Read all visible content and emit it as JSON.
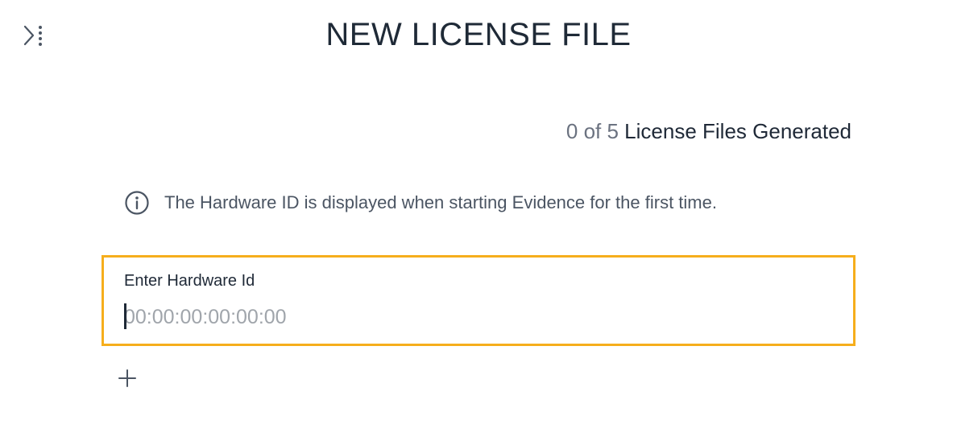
{
  "header": {
    "title": "NEW LICENSE FILE",
    "toggle_icon": "sidebar-expand-icon"
  },
  "counter": {
    "count_text": "0 of 5",
    "label": " License Files Generated"
  },
  "info": {
    "icon": "info-icon",
    "text": "The Hardware ID is displayed when starting Evidence for the first time."
  },
  "hardware_field": {
    "label": "Enter Hardware Id",
    "value": "",
    "placeholder": "00:00:00:00:00:00",
    "focus_color": "#f6ae1c"
  },
  "add": {
    "icon": "plus-icon"
  }
}
